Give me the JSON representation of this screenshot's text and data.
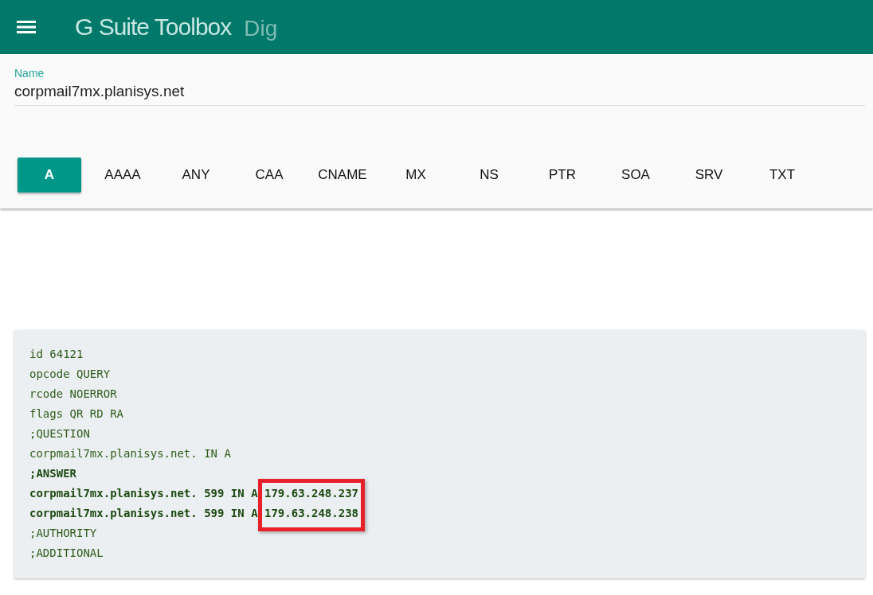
{
  "app_bar": {
    "title": "G Suite Toolbox",
    "subtitle": "Dig"
  },
  "name_field": {
    "label": "Name",
    "value": "corpmail7mx.planisys.net"
  },
  "record_types": [
    {
      "label": "A",
      "selected": true
    },
    {
      "label": "AAAA",
      "selected": false
    },
    {
      "label": "ANY",
      "selected": false
    },
    {
      "label": "CAA",
      "selected": false
    },
    {
      "label": "CNAME",
      "selected": false
    },
    {
      "label": "MX",
      "selected": false
    },
    {
      "label": "NS",
      "selected": false
    },
    {
      "label": "PTR",
      "selected": false
    },
    {
      "label": "SOA",
      "selected": false
    },
    {
      "label": "SRV",
      "selected": false
    },
    {
      "label": "TXT",
      "selected": false
    }
  ],
  "output_lines": [
    {
      "text": "id 64121",
      "bold": false,
      "highlighted": false
    },
    {
      "text": "opcode QUERY",
      "bold": false,
      "highlighted": false
    },
    {
      "text": "rcode NOERROR",
      "bold": false,
      "highlighted": false
    },
    {
      "text": "flags QR RD RA",
      "bold": false,
      "highlighted": false
    },
    {
      "text": ";QUESTION",
      "bold": false,
      "highlighted": false
    },
    {
      "text": "corpmail7mx.planisys.net. IN A",
      "bold": false,
      "highlighted": false
    },
    {
      "text": ";ANSWER",
      "bold": true,
      "highlighted": false
    },
    {
      "text": "corpmail7mx.planisys.net. 599 IN A 179.63.248.237",
      "bold": true,
      "highlighted": true
    },
    {
      "text": "corpmail7mx.planisys.net. 599 IN A 179.63.248.238",
      "bold": true,
      "highlighted": true
    },
    {
      "text": ";AUTHORITY",
      "bold": false,
      "highlighted": false
    },
    {
      "text": ";ADDITIONAL",
      "bold": false,
      "highlighted": false
    }
  ]
}
